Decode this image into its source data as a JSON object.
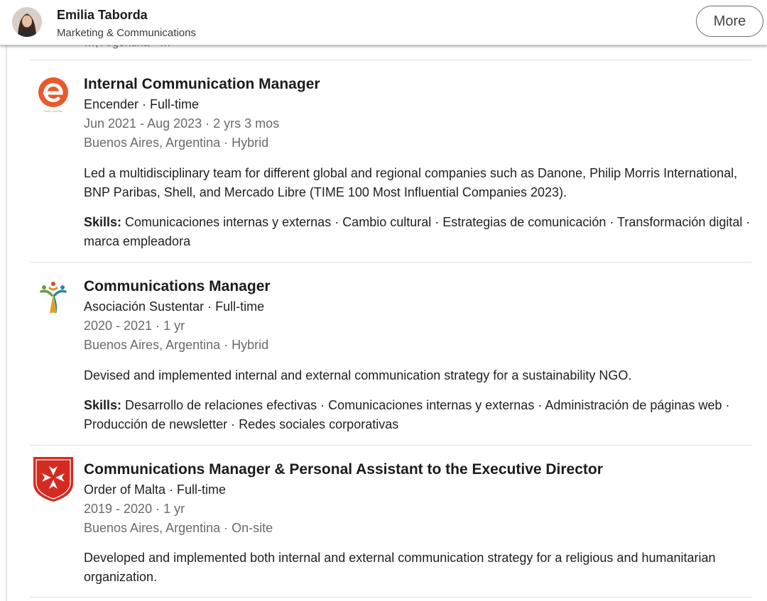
{
  "header": {
    "name": "Emilia Taborda",
    "headline": "Marketing & Communications",
    "more_label": "More"
  },
  "cut_off_text": "…, Argentina · …",
  "experience": [
    {
      "title": "Internal Communication Manager",
      "company_line": "Encender · Full-time",
      "dates": "Jun 2021 - Aug 2023 · 2 yrs 3 mos",
      "location": "Buenos Aires, Argentina · Hybrid",
      "description": "Led a multidisciplinary team for different global and regional companies such as Danone, Philip Morris International, BNP Paribas, Shell, and Mercado Libre (TIME 100 Most Influential Companies 2023).",
      "skills_label": "Skills:",
      "skills": "Comunicaciones internas y externas · Cambio cultural · Estrategias de comunicación · Transformación digital · marca empleadora",
      "logo_caption": "DATA DIGITAL"
    },
    {
      "title": "Communications Manager",
      "company_line": "Asociación Sustentar · Full-time",
      "dates": "2020 - 2021 · 1 yr",
      "location": "Buenos Aires, Argentina · Hybrid",
      "description": "Devised and implemented internal and external communication strategy for a sustainability NGO.",
      "skills_label": "Skills:",
      "skills": "Desarrollo de relaciones efectivas · Comunicaciones internas y externas · Administración de páginas web · Producción de newsletter · Redes sociales corporativas"
    },
    {
      "title": "Communications Manager & Personal Assistant to the Executive Director",
      "company_line": "Order of Malta · Full-time",
      "dates": "2019 - 2020 · 1 yr",
      "location": "Buenos Aires, Argentina · On-site",
      "description": "Developed and implemented both internal and external communication strategy for a religious and humanitarian organization."
    }
  ],
  "colors": {
    "encender_orange": "#e8592b",
    "malta_red": "#d32b22",
    "text_muted": "#6a6a6a"
  }
}
